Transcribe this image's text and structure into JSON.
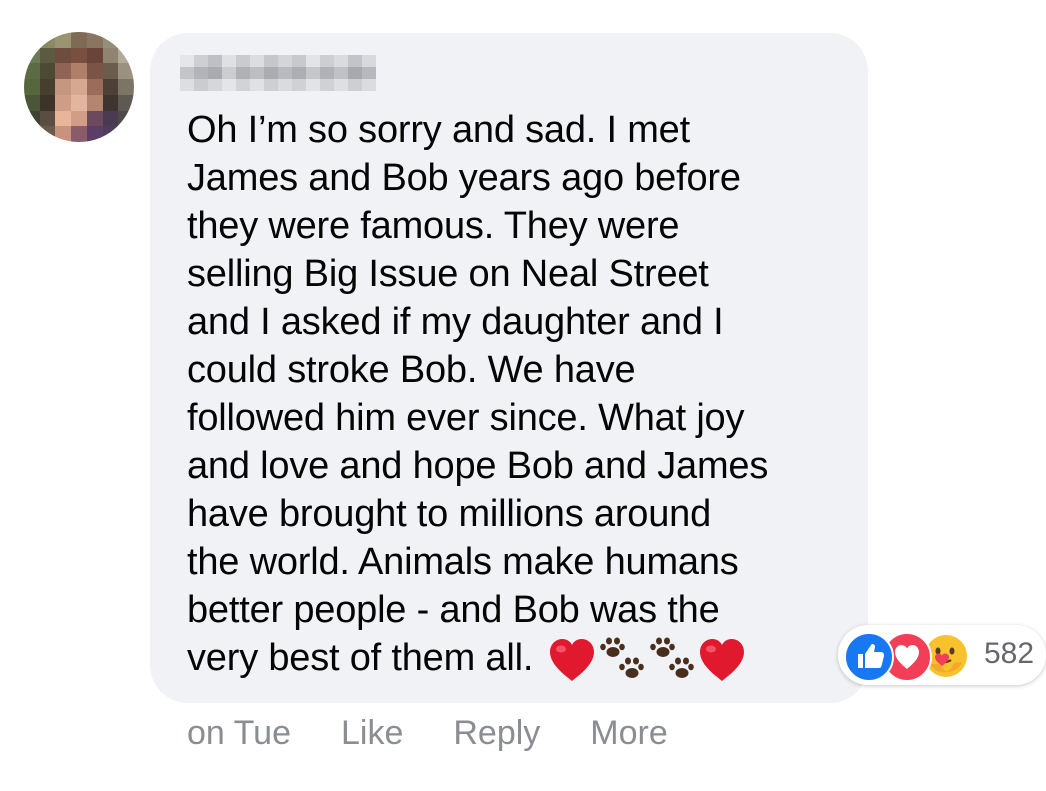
{
  "comment": {
    "lines": [
      "Oh I’m so sorry and sad. I met",
      "James and Bob years ago before",
      "they were famous. They were",
      "selling Big Issue on Neal Street",
      "and I asked if my daughter and I",
      "could stroke Bob. We have",
      "followed him ever since. What joy",
      "and love and hope Bob and James",
      "have brought to millions around",
      "the world. Animals make humans",
      "better people - and Bob was the",
      "very best of them all."
    ],
    "trailing_emoji": [
      "red-heart",
      "paw-prints",
      "paw-prints",
      "red-heart"
    ]
  },
  "reactions": {
    "types": [
      "like",
      "love",
      "care"
    ],
    "count": "582"
  },
  "actions": {
    "timestamp": "on Tue",
    "like": "Like",
    "reply": "Reply",
    "more": "More"
  },
  "colors": {
    "bubble": "#f0f2f5",
    "text": "#050505",
    "meta": "#8a8d91",
    "like_blue": "#1877f2",
    "love_red": "#f33e58"
  }
}
